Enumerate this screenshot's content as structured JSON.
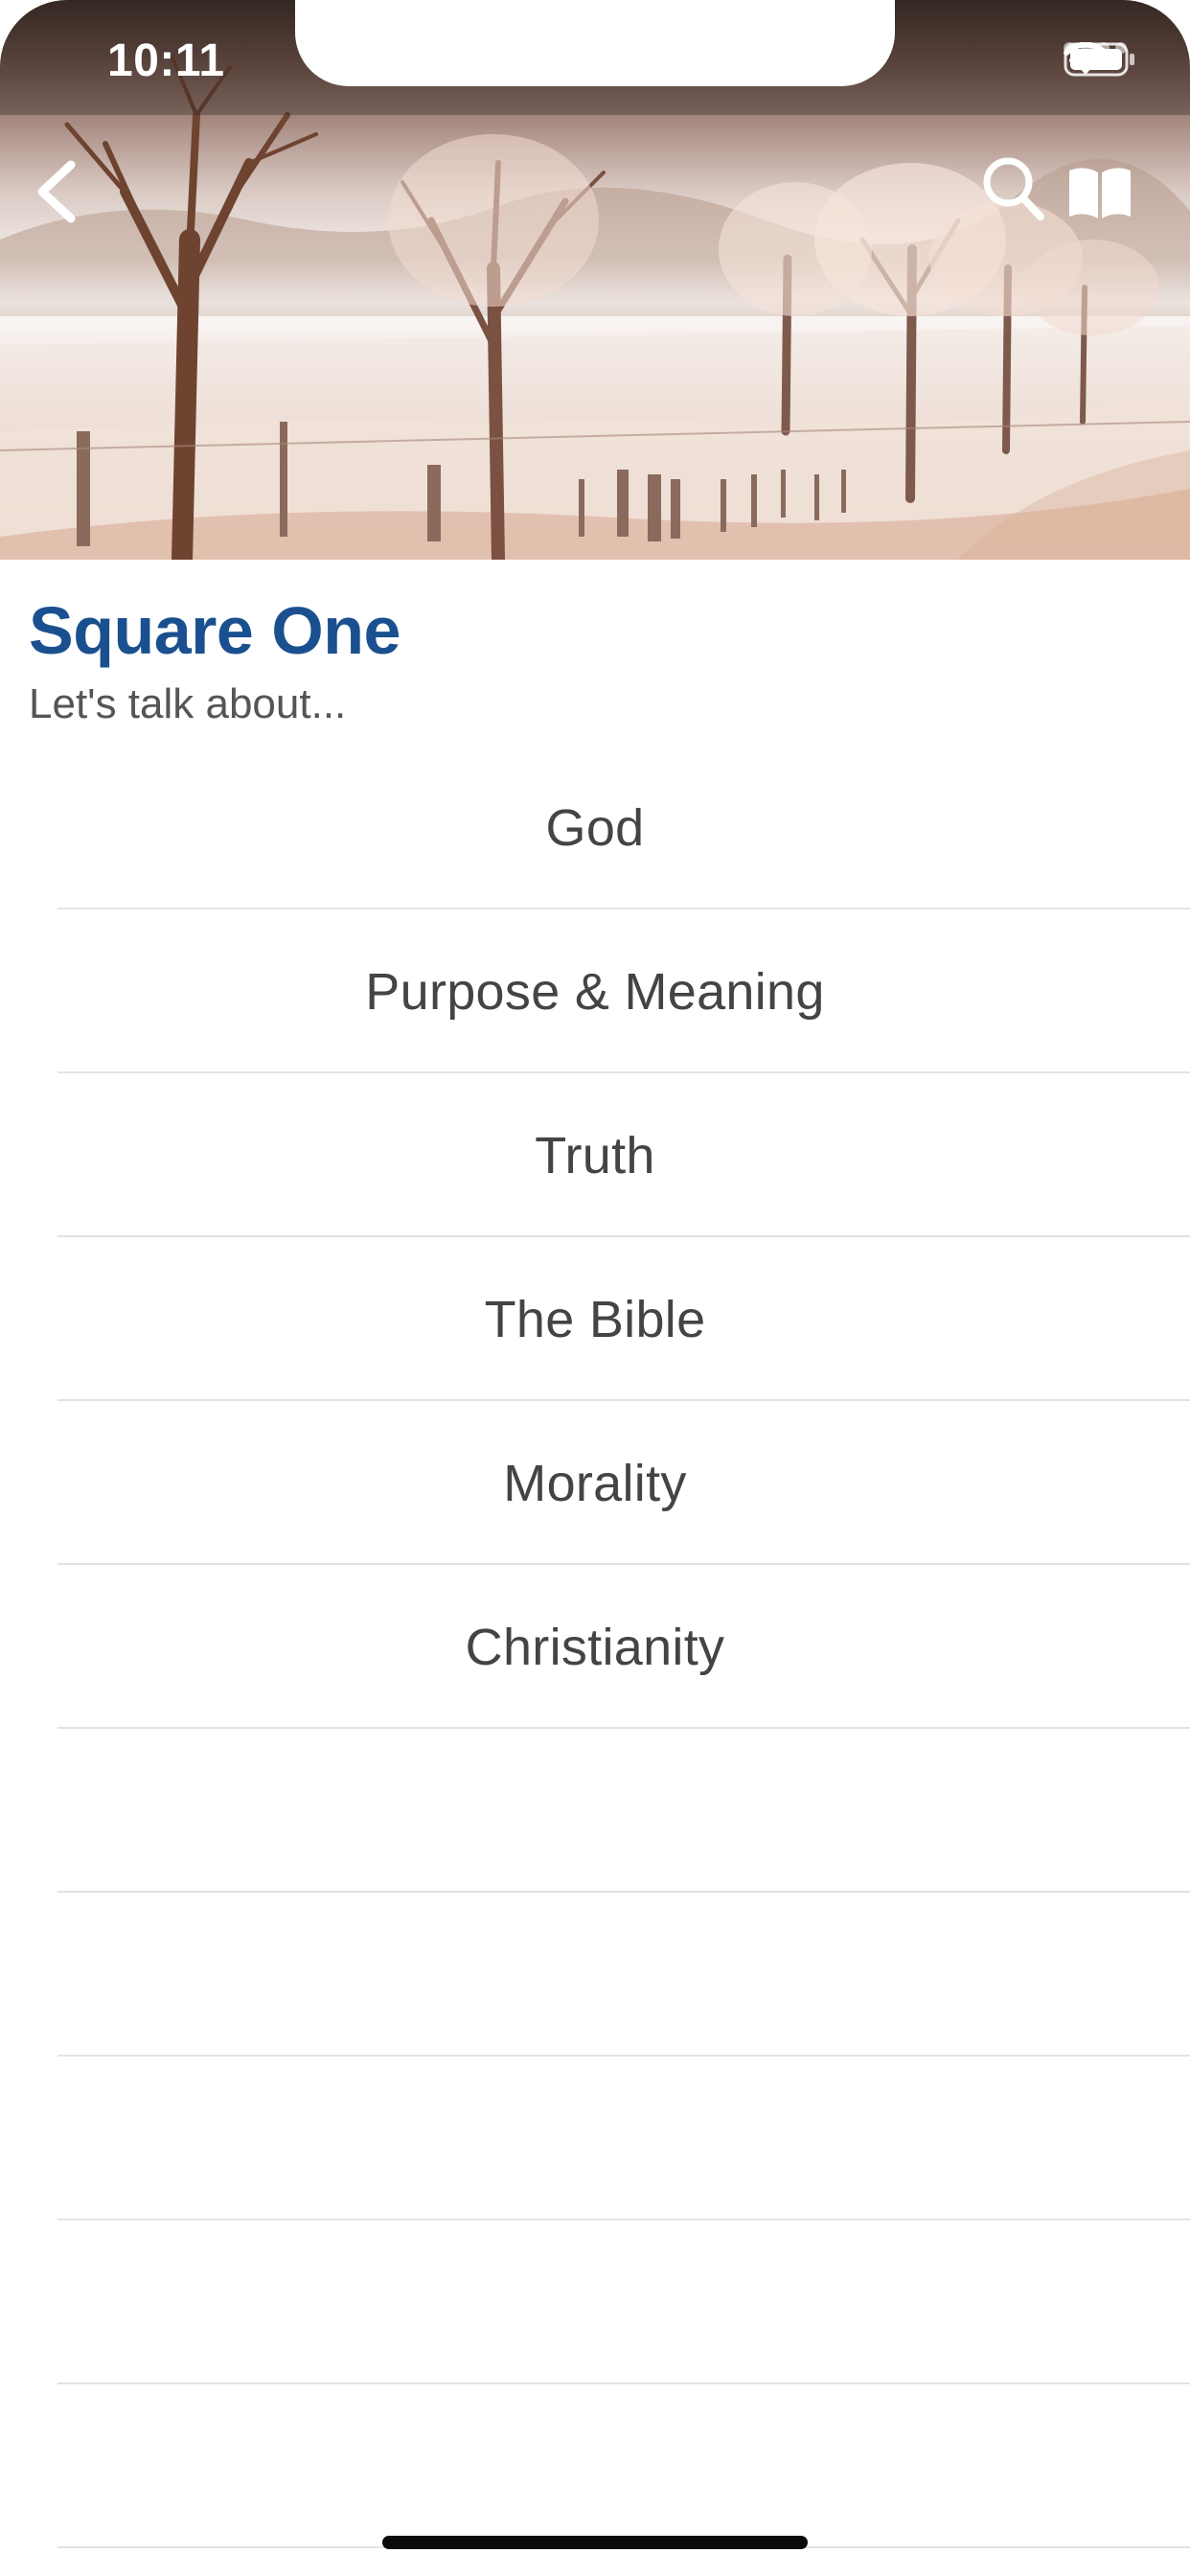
{
  "status_bar": {
    "time": "10:11"
  },
  "nav": {
    "back_icon": "chevron-left-icon",
    "search_icon": "search-icon",
    "book_icon": "book-icon"
  },
  "header": {
    "title": "Square One",
    "subtitle": "Let's talk about..."
  },
  "topics": [
    {
      "label": "God"
    },
    {
      "label": "Purpose & Meaning"
    },
    {
      "label": "Truth"
    },
    {
      "label": "The Bible"
    },
    {
      "label": "Morality"
    },
    {
      "label": "Christianity"
    },
    {
      "label": ""
    },
    {
      "label": ""
    },
    {
      "label": ""
    },
    {
      "label": ""
    },
    {
      "label": ""
    }
  ],
  "colors": {
    "title": "#1a508f",
    "subtitle": "#555555",
    "row_text": "#444444",
    "separator": "#e3e3e3"
  }
}
